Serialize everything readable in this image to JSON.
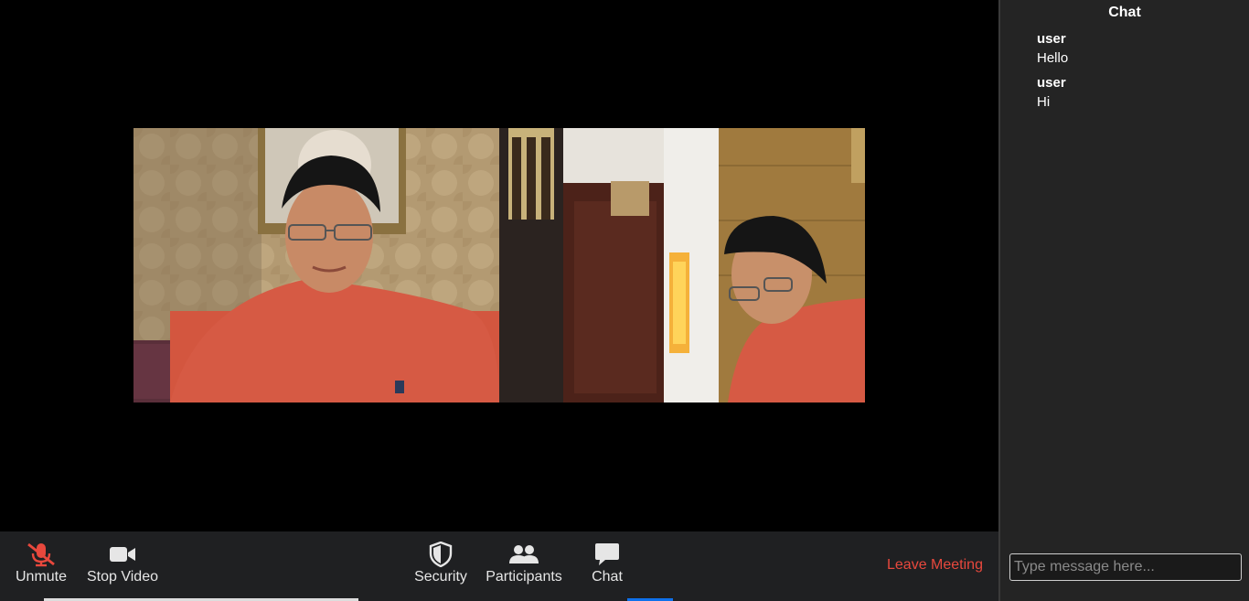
{
  "toolbar": {
    "unmute_label": "Unmute",
    "stop_video_label": "Stop Video",
    "security_label": "Security",
    "participants_label": "Participants",
    "chat_label": "Chat",
    "leave_label": "Leave Meeting"
  },
  "chat": {
    "title": "Chat",
    "messages": [
      {
        "sender": "user",
        "text": "Hello"
      },
      {
        "sender": "user",
        "text": "Hi"
      }
    ],
    "input_placeholder": "Type message here..."
  },
  "icons": {
    "unmute": "microphone-muted-icon",
    "stop_video": "video-camera-icon",
    "security": "shield-icon",
    "participants": "people-icon",
    "chat": "speech-bubble-icon"
  },
  "colors": {
    "toolbar_bg": "#1f2022",
    "leave": "#e8483d",
    "muted_mic": "#e8483d",
    "chat_bg": "#242424"
  }
}
